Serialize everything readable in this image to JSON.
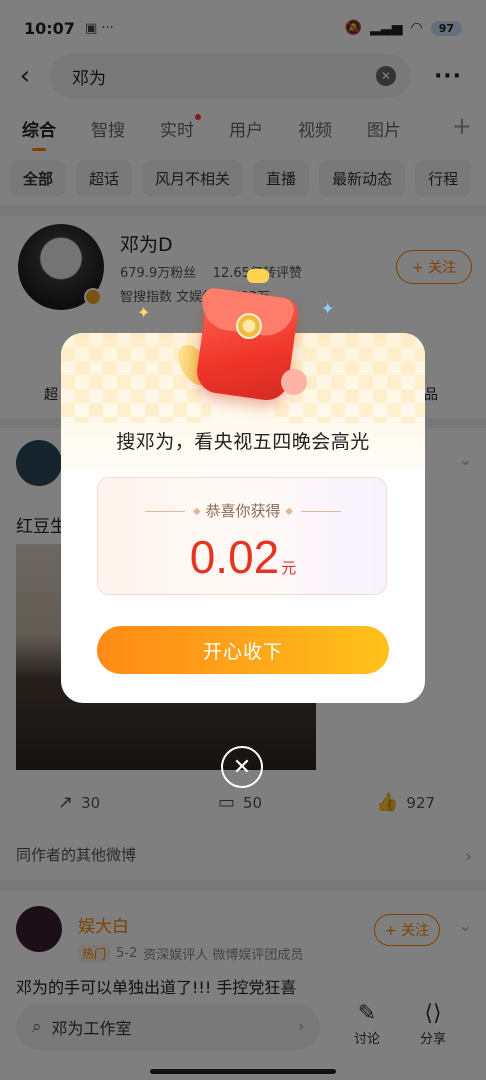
{
  "status_bar": {
    "time": "10:07",
    "battery": "97"
  },
  "search": {
    "query": "邓为"
  },
  "tabs": [
    {
      "label": "综合"
    },
    {
      "label": "智搜"
    },
    {
      "label": "实时"
    },
    {
      "label": "用户"
    },
    {
      "label": "视频"
    },
    {
      "label": "图片"
    }
  ],
  "tab_add": "+",
  "filters": [
    "全部",
    "超话",
    "风月不相关",
    "直播",
    "最新动态",
    "行程"
  ],
  "profile": {
    "name": "邓为D",
    "fans": "679.9万粉丝",
    "likes": "12.65亿转评赞",
    "index": "智搜指数 文娱领域 793万",
    "follow_label": "+ 关注"
  },
  "quicklinks": {
    "left_label": "超",
    "right_label": "品"
  },
  "post": {
    "text": "红豆生",
    "reposts": "30",
    "comments": "50",
    "likes": "927"
  },
  "same_author": "同作者的其他微博",
  "post2": {
    "name": "娱大白",
    "tag": "热门",
    "date": "5-2",
    "meta": "资深娱评人 微博娱评团成员",
    "follow_label": "+ 关注",
    "text": "邓为的手可以单独出道了!!! 手控党狂喜"
  },
  "bottom_bar": {
    "search_placeholder": "邓为工作室",
    "discuss_label": "讨论",
    "share_label": "分享"
  },
  "dialog": {
    "title": "搜邓为，看央视五四晚会高光",
    "prize_label": "恭喜你获得",
    "amount": "0.02",
    "unit": "元",
    "accept_label": "开心收下"
  },
  "colors": {
    "accent": "#ff8200",
    "prize_red": "#e63322",
    "button_start": "#ff8a16",
    "button_end": "#ffc21a"
  }
}
